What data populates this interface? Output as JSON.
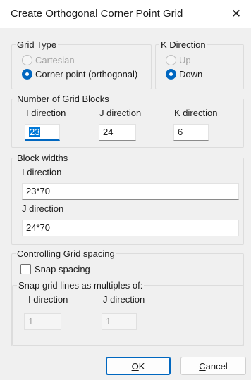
{
  "window": {
    "title": "Create Orthogonal Corner Point Grid",
    "close_symbol": "✕"
  },
  "grid_type": {
    "legend": "Grid Type",
    "options": [
      {
        "label": "Cartesian",
        "selected": false,
        "enabled": false
      },
      {
        "label": "Corner point (orthogonal)",
        "selected": true,
        "enabled": true
      }
    ]
  },
  "k_direction": {
    "legend": "K Direction",
    "options": [
      {
        "label": "Up",
        "selected": false,
        "enabled": false
      },
      {
        "label": "Down",
        "selected": true,
        "enabled": true
      }
    ]
  },
  "grid_blocks": {
    "legend": "Number of Grid Blocks",
    "i_label": "I direction",
    "i_value": "23",
    "j_label": "J direction",
    "j_value": "24",
    "k_label": "K direction",
    "k_value": "6"
  },
  "block_widths": {
    "legend": "Block widths",
    "i_label": "I direction",
    "i_value": "23*70",
    "j_label": "J direction",
    "j_value": "24*70"
  },
  "grid_spacing": {
    "legend": "Controlling Grid spacing",
    "snap_label": "Snap spacing",
    "snap_checked": false,
    "multiples_legend": "Snap grid lines as multiples of:",
    "i_label": "I direction",
    "i_value": "1",
    "j_label": "J direction",
    "j_value": "1"
  },
  "buttons": {
    "ok_mnemonic": "O",
    "ok_rest": "K",
    "cancel_mnemonic": "C",
    "cancel_rest": "ancel"
  }
}
